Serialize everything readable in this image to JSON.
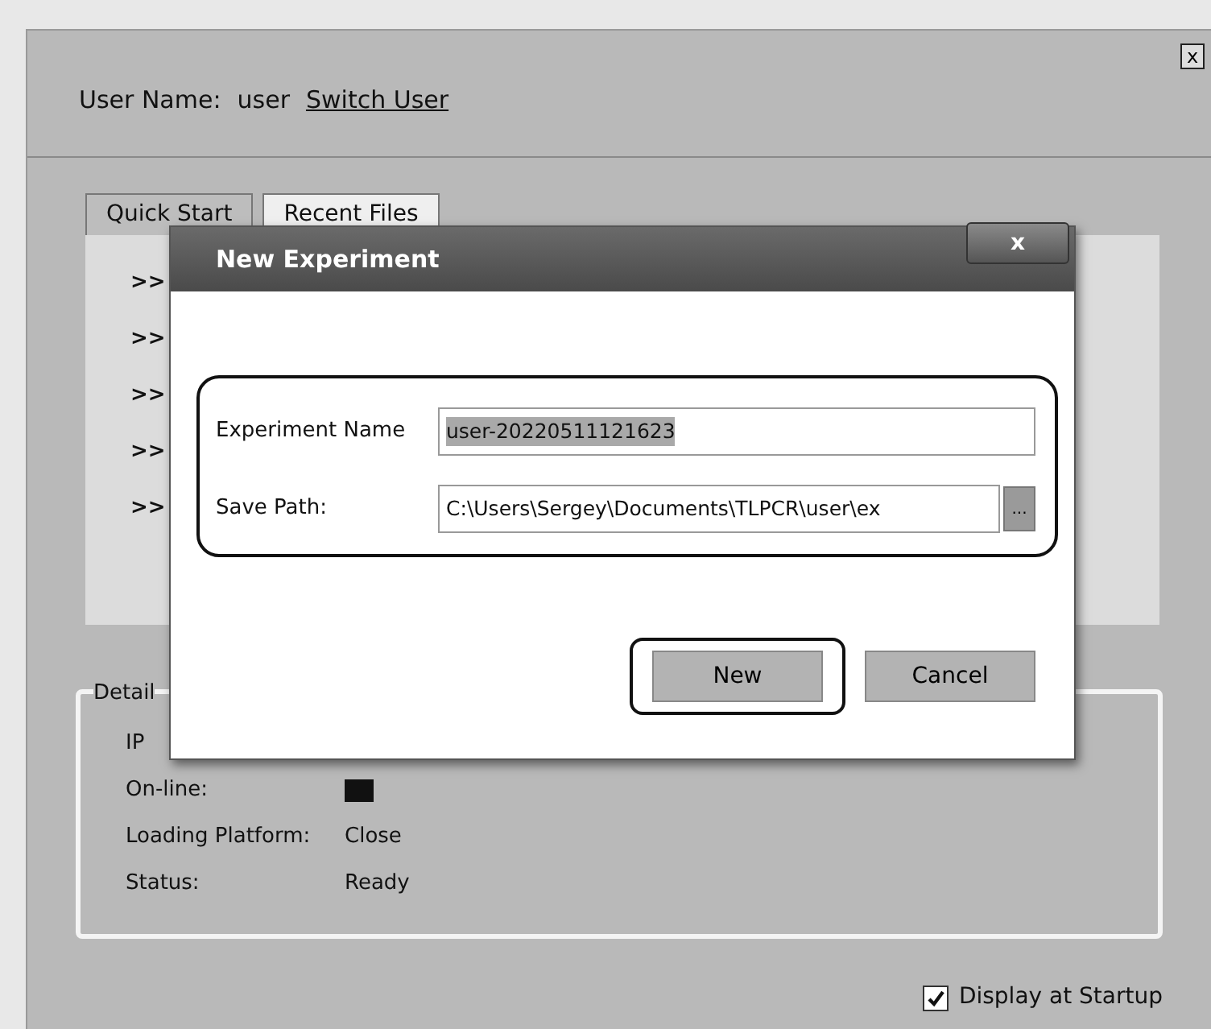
{
  "window": {
    "close": "x"
  },
  "header": {
    "label": "User Name:",
    "user": "user",
    "link": "Switch User"
  },
  "tabs": [
    {
      "label": "Quick Start",
      "selected": true
    },
    {
      "label": "Recent Files",
      "selected": false
    }
  ],
  "quick_start_items": [
    ">>",
    ">>",
    ">>",
    ">>",
    ">>"
  ],
  "details": {
    "title": "Detail",
    "rows": [
      {
        "kind": "text",
        "label": "IP"
      },
      {
        "kind": "indicator",
        "label": "On-line:",
        "on": true
      },
      {
        "kind": "text",
        "label": "Loading Platform:",
        "value": "Close"
      },
      {
        "kind": "text",
        "label": "Status:",
        "value": "Ready"
      }
    ]
  },
  "display_at_startup": {
    "label": "Display at Startup",
    "checked": true
  },
  "dialog": {
    "title": "New Experiment",
    "close": "x",
    "fields": [
      {
        "label": "Experiment Name",
        "value": "user-20220511121623",
        "selected_text": true,
        "browse": false
      },
      {
        "label": "Save Path:",
        "value": "C:\\Users\\Sergey\\Documents\\TLPCR\\user\\ex",
        "selected_text": false,
        "browse": true,
        "browse_label": "..."
      }
    ],
    "buttons": [
      {
        "label": "New",
        "highlighted": true
      },
      {
        "label": "Cancel",
        "highlighted": false
      }
    ]
  }
}
